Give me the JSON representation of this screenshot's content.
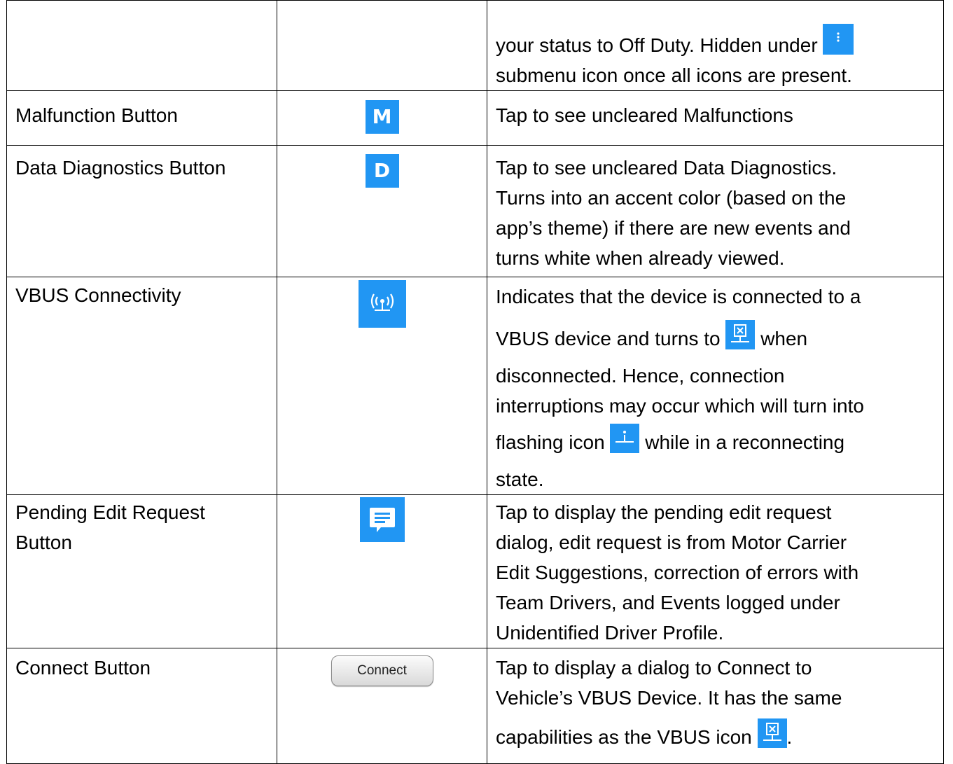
{
  "colors": {
    "icon_blue": "#2196f3",
    "border": "#000000"
  },
  "rows": [
    {
      "name": "",
      "icon": "kebab-menu-icon",
      "desc_lines": [
        "your status to Off Duty. Hidden under",
        "submenu icon once all icons are present."
      ]
    },
    {
      "name": "Malfunction Button",
      "icon_letter": "M",
      "desc_lines": [
        "Tap to see uncleared Malfunctions"
      ]
    },
    {
      "name": "Data Diagnostics Button",
      "icon_letter": "D",
      "desc_lines": [
        "Tap to see uncleared Data Diagnostics.",
        "Turns into an accent color (based on the",
        "app’s theme) if there are new events and",
        "turns white when already viewed."
      ]
    },
    {
      "name": "VBUS Connectivity",
      "icon": "vbus-connected-icon",
      "desc_lines": [
        "Indicates that the device is connected to a",
        "VBUS device and turns to",
        "when",
        "disconnected. Hence, connection",
        "interruptions may occur which will turn into",
        "flashing icon",
        "while in a reconnecting",
        "state."
      ]
    },
    {
      "name_lines": [
        "Pending Edit Request",
        "Button"
      ],
      "icon": "edit-request-icon",
      "desc_lines": [
        "Tap to display the pending edit request",
        "dialog, edit request is from Motor Carrier",
        "Edit Suggestions, correction of errors with",
        "Team Drivers, and Events logged under",
        "Unidentified Driver Profile."
      ]
    },
    {
      "name": "Connect Button",
      "button_label": "Connect",
      "desc_lines": [
        "Tap to display a dialog to Connect to",
        "Vehicle’s VBUS Device. It has the same",
        "capabilities as the VBUS icon",
        "."
      ]
    }
  ]
}
